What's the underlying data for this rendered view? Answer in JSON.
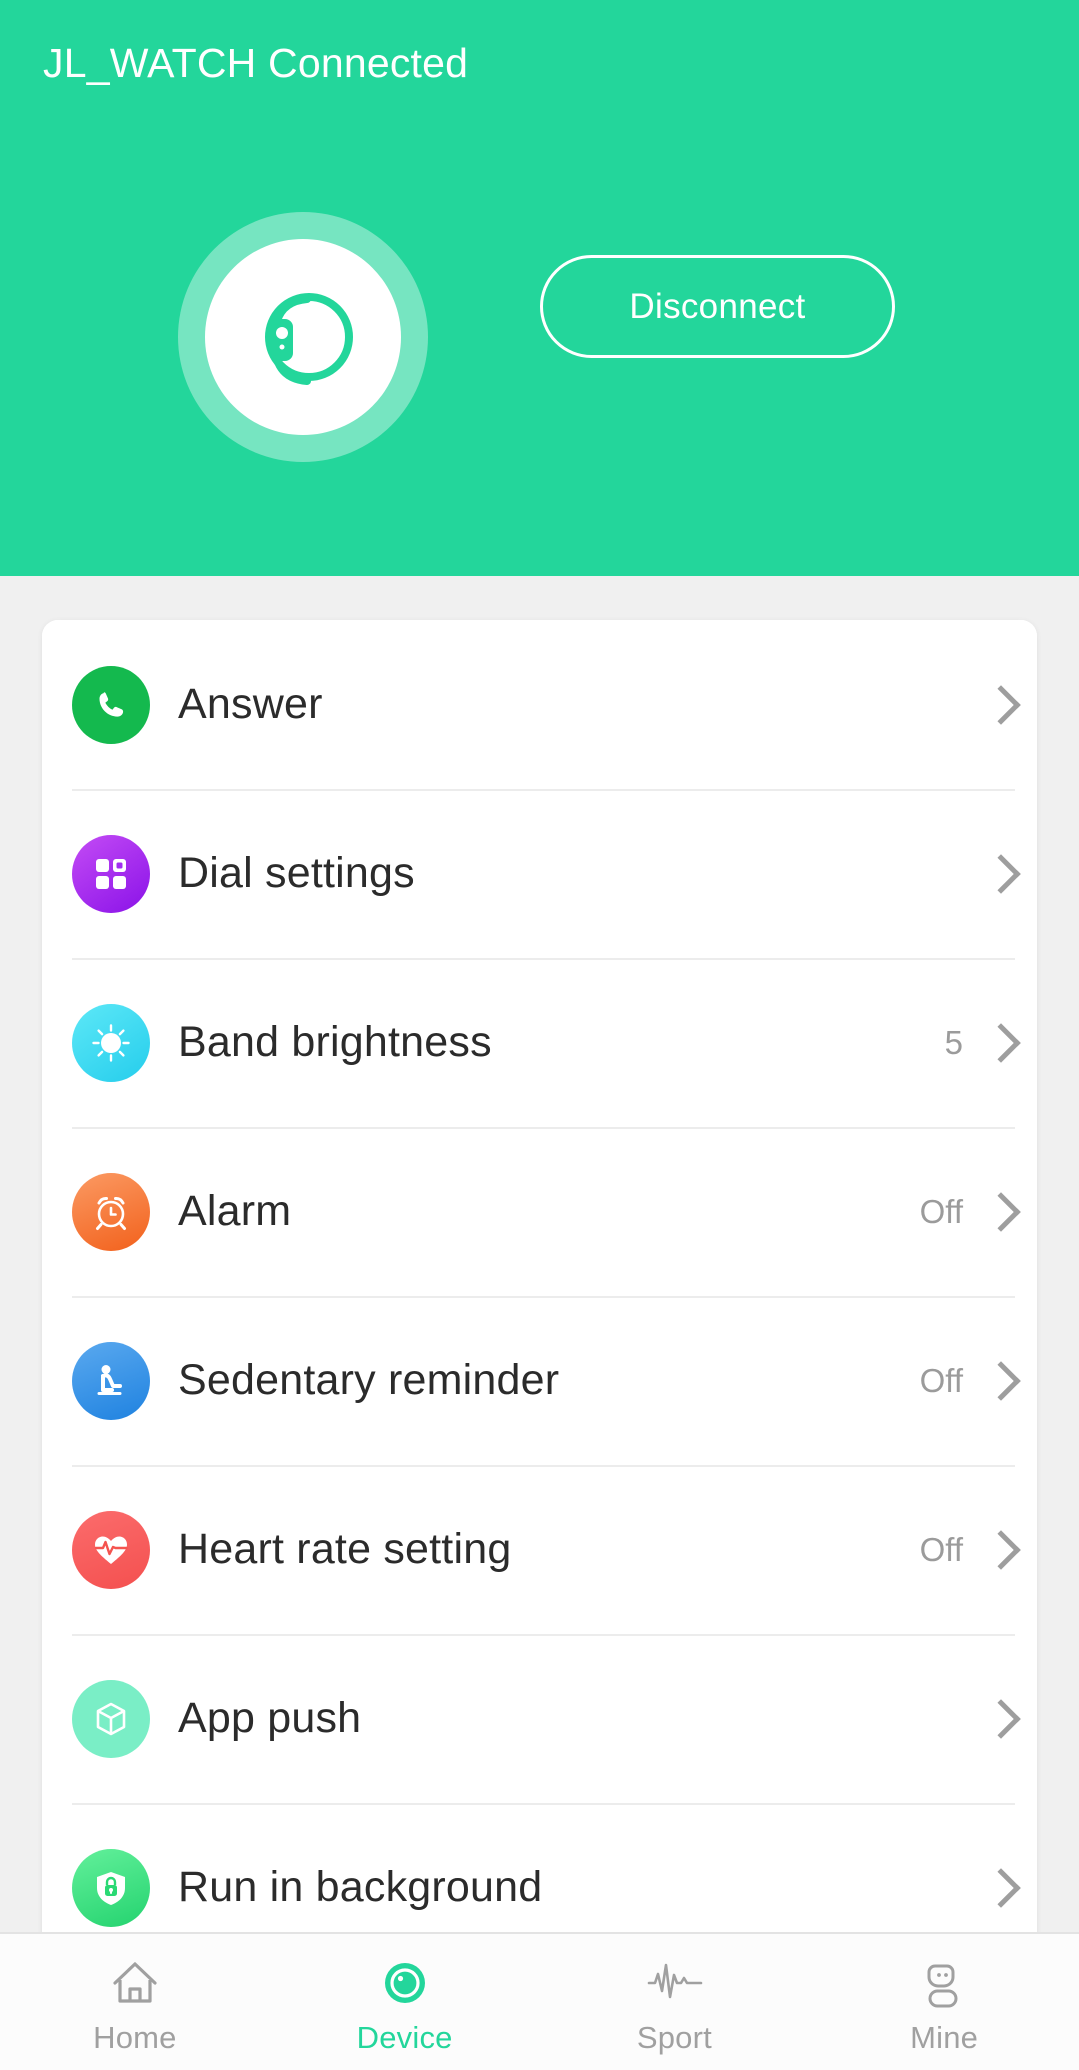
{
  "header": {
    "title": "JL_WATCH Connected",
    "disconnect_label": "Disconnect",
    "device_icon": "watch-icon",
    "background_color": "#23d69b"
  },
  "settings_list": [
    {
      "label": "Answer",
      "value": "",
      "icon": "phone-icon",
      "icon_color": "#14b94e",
      "icon_class": "bg-answer",
      "name": "answer"
    },
    {
      "label": "Dial settings",
      "value": "",
      "icon": "grid-icon",
      "icon_color": "#a12ef0",
      "icon_class": "bg-dial",
      "name": "dial-settings"
    },
    {
      "label": "Band brightness",
      "value": "5",
      "icon": "brightness-icon",
      "icon_color": "#2ed2ee",
      "icon_class": "bg-brightness",
      "name": "band-brightness"
    },
    {
      "label": "Alarm",
      "value": "Off",
      "icon": "alarm-clock-icon",
      "icon_color": "#f4691f",
      "icon_class": "bg-alarm",
      "name": "alarm"
    },
    {
      "label": "Sedentary reminder",
      "value": "Off",
      "icon": "sitting-person-icon",
      "icon_color": "#2589e2",
      "icon_class": "bg-sedentary",
      "name": "sedentary-reminder"
    },
    {
      "label": "Heart rate setting",
      "value": "Off",
      "icon": "heart-pulse-icon",
      "icon_color": "#f4544f",
      "icon_class": "bg-heart",
      "name": "heart-rate-setting"
    },
    {
      "label": "App push",
      "value": "",
      "icon": "cube-icon",
      "icon_color": "#7aeec6",
      "icon_class": "bg-apppush",
      "name": "app-push"
    },
    {
      "label": "Run in background",
      "value": "",
      "icon": "lock-shield-icon",
      "icon_color": "#2ad974",
      "icon_class": "bg-runbg",
      "name": "run-in-background"
    }
  ],
  "tabbar": {
    "active": "Device",
    "active_color": "#23d69b",
    "inactive_color": "#a0a0a0",
    "items": [
      {
        "label": "Home",
        "icon": "home-icon",
        "name": "home"
      },
      {
        "label": "Device",
        "icon": "device-icon",
        "name": "device"
      },
      {
        "label": "Sport",
        "icon": "sport-icon",
        "name": "sport"
      },
      {
        "label": "Mine",
        "icon": "person-icon",
        "name": "mine"
      }
    ]
  }
}
